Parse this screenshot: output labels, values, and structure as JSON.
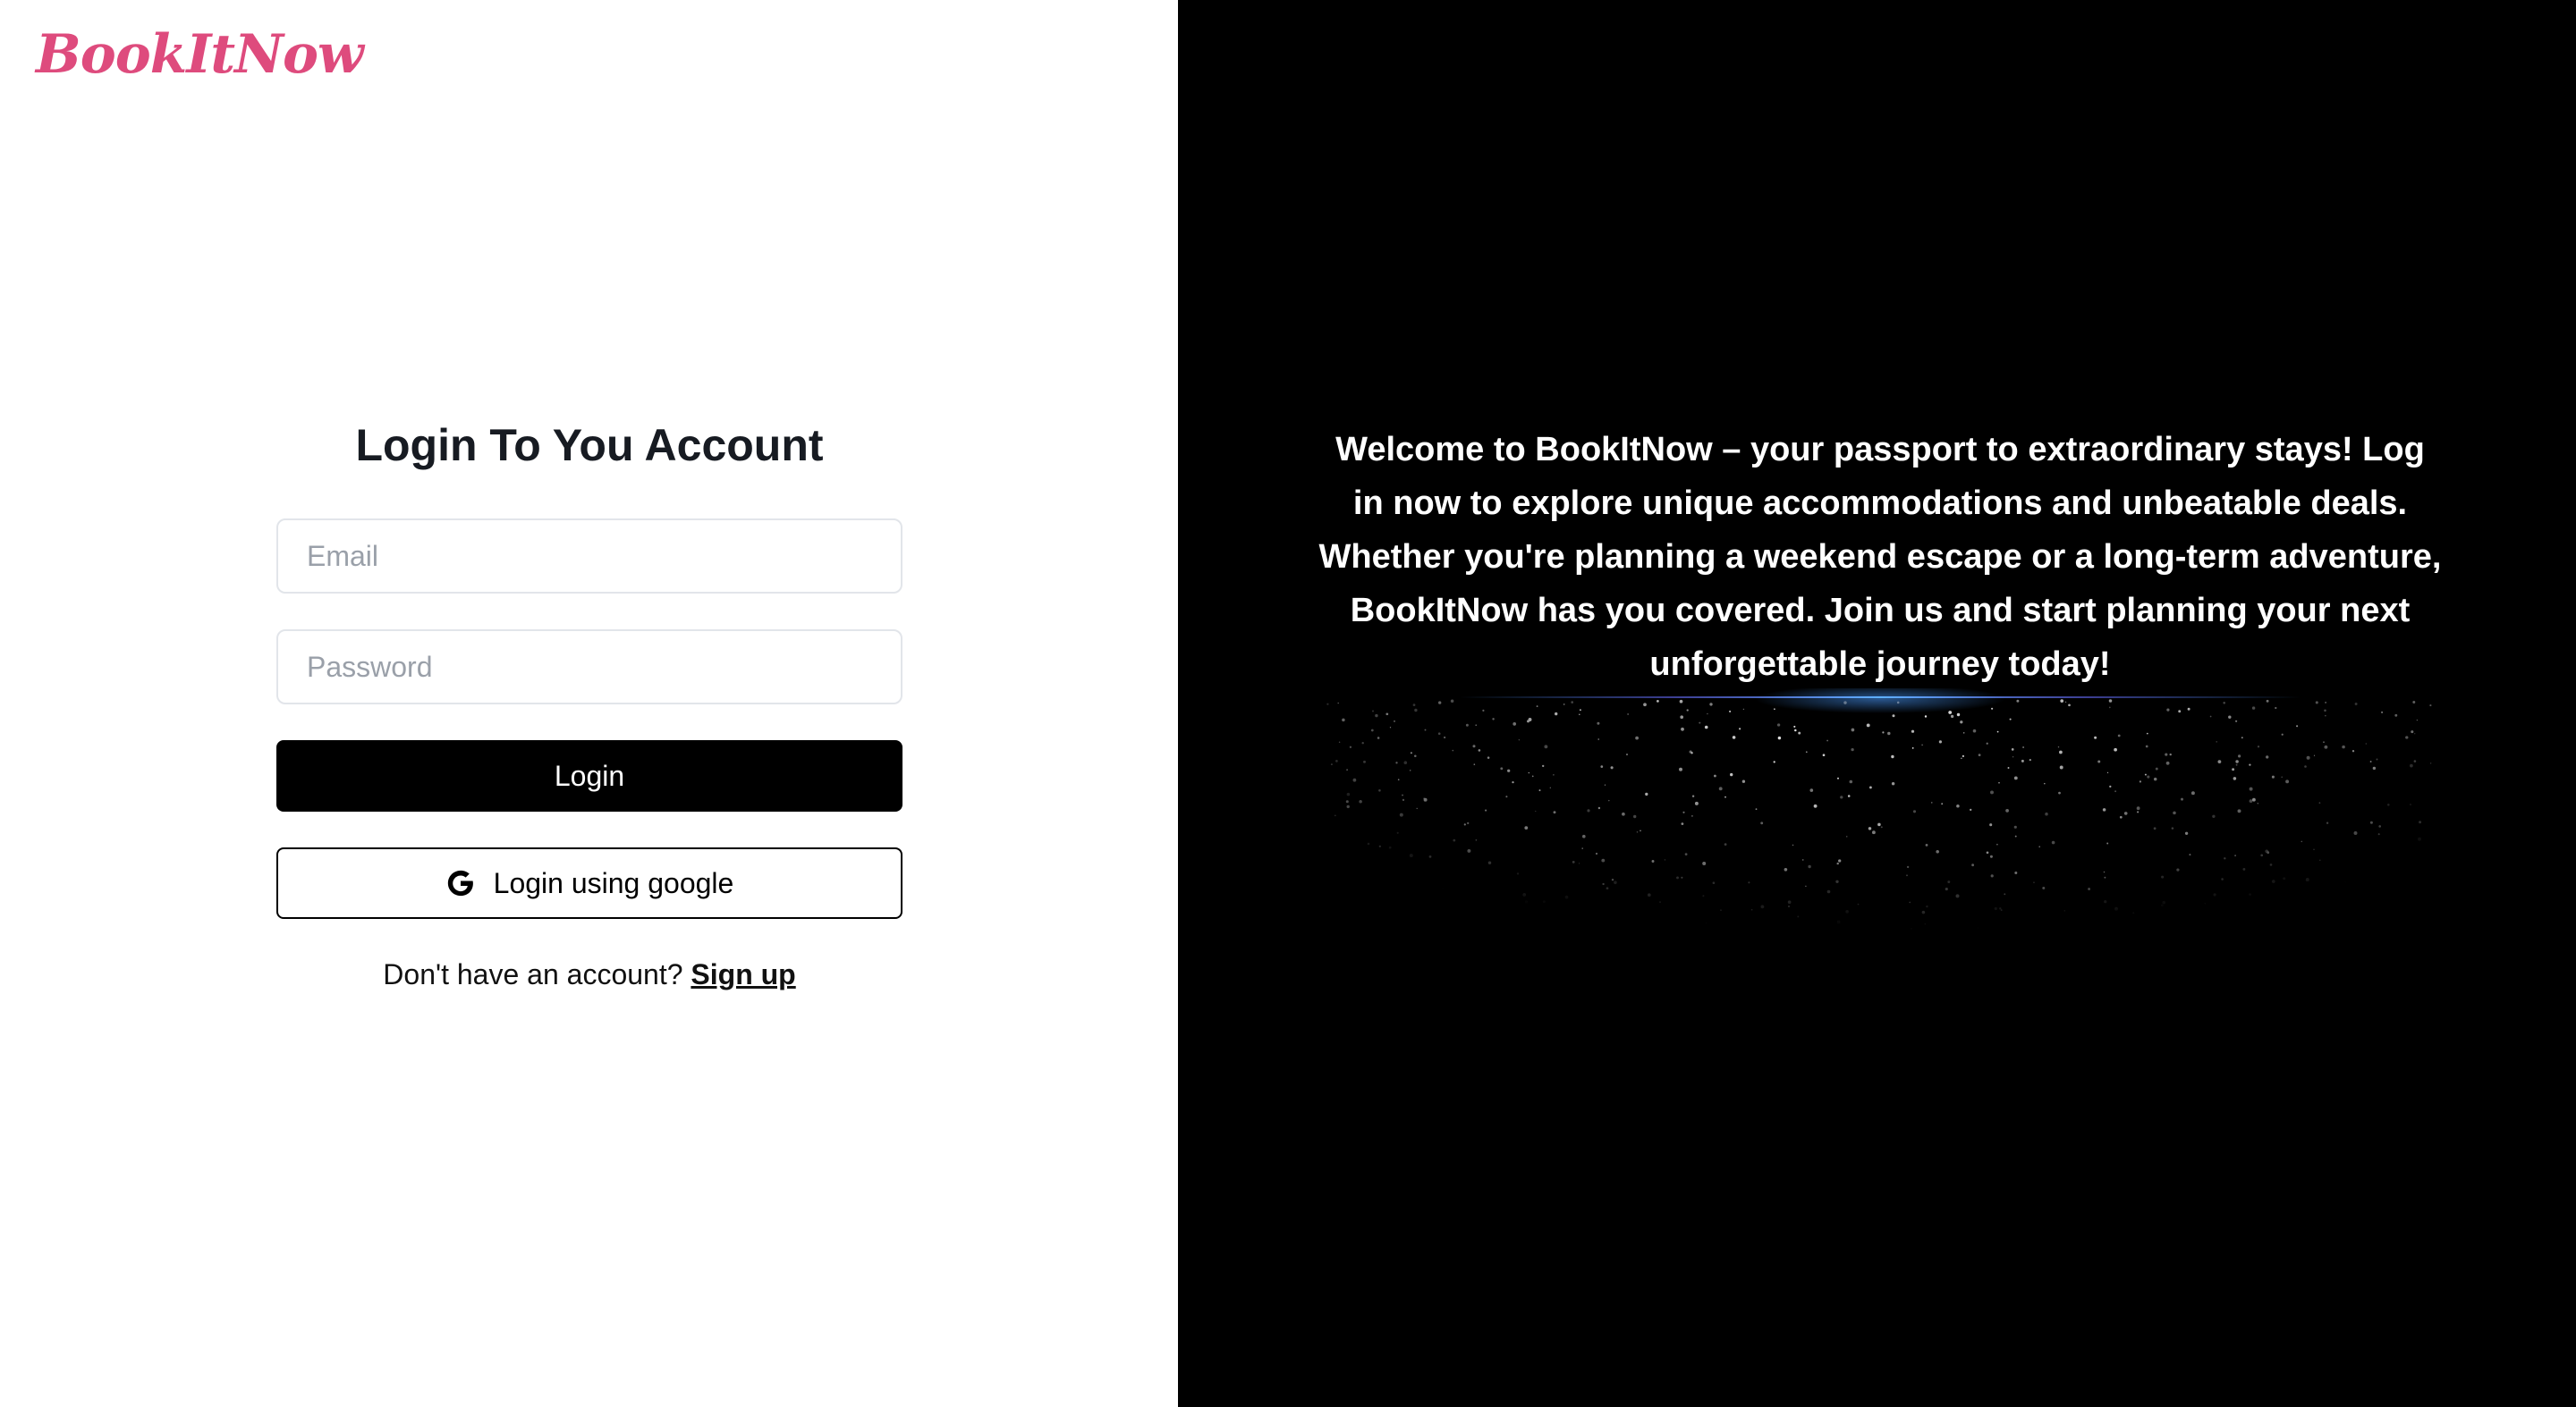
{
  "brand": {
    "name": "BookItNow",
    "color": "#de4b7d"
  },
  "login_form": {
    "title": "Login To You Account",
    "email_placeholder": "Email",
    "email_value": "",
    "password_placeholder": "Password",
    "password_value": "",
    "login_button": "Login",
    "google_button": "Login using google",
    "google_icon": "google-g-icon",
    "signup_prompt": "Don't have an account?",
    "signup_link": "Sign up"
  },
  "hero": {
    "text": "Welcome to BookItNow – your passport to extraordinary stays! Log in now to explore unique accommodations and unbeatable deals. Whether you're planning a weekend escape or a long-term adventure, BookItNow has you covered. Join us and start planning your next unforgettable journey today!",
    "background": "#000000",
    "glow_color": "#4a9bff",
    "decoration": "sparkles"
  }
}
